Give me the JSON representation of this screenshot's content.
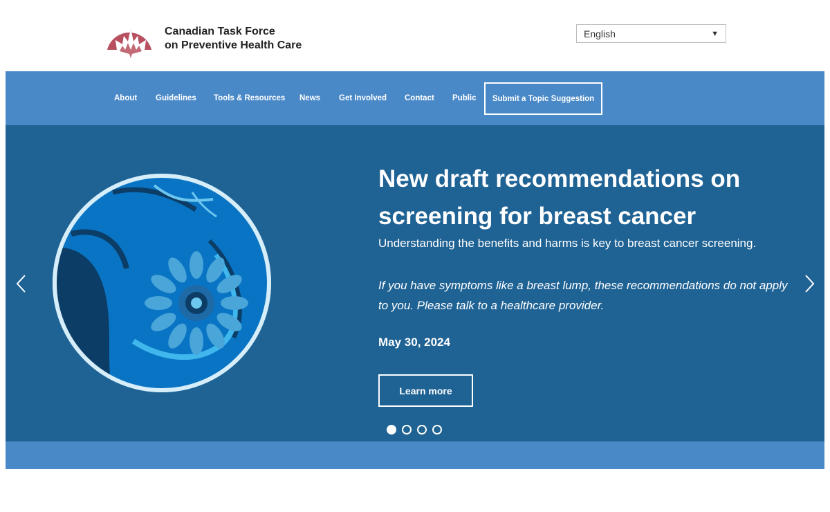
{
  "header": {
    "logo_line1": "Canadian Task Force",
    "logo_line2": "on Preventive Health Care",
    "language_selected": "English"
  },
  "nav": {
    "items": [
      "About",
      "Guidelines",
      "Tools & Resources",
      "News",
      "Get Involved",
      "Contact",
      "Public"
    ],
    "cta": "Submit a Topic Suggestion"
  },
  "hero": {
    "title": "New draft recommendations on screening for breast cancer",
    "subtitle": "Understanding the benefits and harms is key to breast cancer screening.",
    "note": "If you have symptoms like a breast lump, these recommendations do not apply to you. Please talk to a healthcare provider.",
    "date": "May 30, 2024",
    "button": "Learn more",
    "slides_total": 4,
    "slide_active": 1
  },
  "colors": {
    "brand_red": "#b8505f",
    "nav_blue": "#4a89c8",
    "hero_blue": "#1f6294"
  },
  "icons": [
    "maple-leaf-logo-icon",
    "chevron-left-icon",
    "chevron-right-icon",
    "dropdown-arrow-icon"
  ]
}
